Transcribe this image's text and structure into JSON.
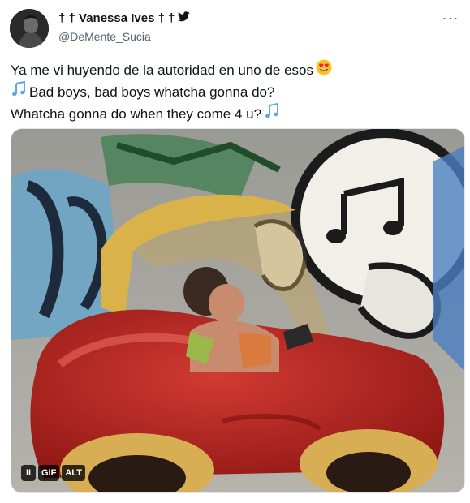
{
  "author": {
    "name": "† † Vanessa Ives † †",
    "handle": "@DeMente_Sucia",
    "avatar": "avatar"
  },
  "tweet": {
    "lines": [
      "Ya me vi huyendo de la autoridad en uno de esos",
      "Bad boys, bad boys whatcha gonna do?",
      "Whatcha gonna do when they come 4 u?"
    ],
    "emojis": [
      "heart-eyes-emoji",
      "musical-notes-icon",
      "musical-notes-icon"
    ]
  },
  "media": {
    "type": "GIF",
    "controls": {
      "pause": "II",
      "gif": "GIF",
      "alt": "ALT"
    }
  },
  "colors": {
    "text": "#0f1419",
    "secondary": "#536471",
    "twitter_blue": "#1d9bf0"
  }
}
